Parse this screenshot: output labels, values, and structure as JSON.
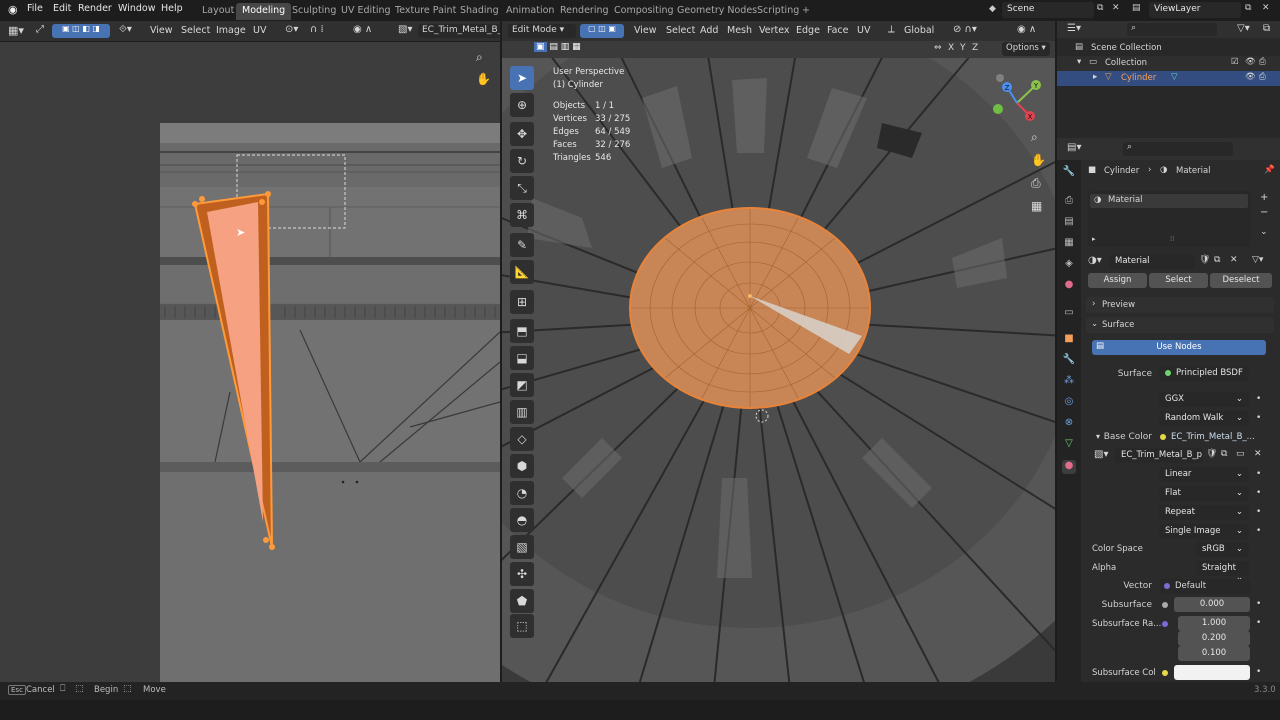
{
  "topbar": {
    "menus": [
      "File",
      "Edit",
      "Render",
      "Window",
      "Help"
    ],
    "workspaces": [
      "Layout",
      "Modeling",
      "Sculpting",
      "UV Editing",
      "Texture Paint",
      "Shading",
      "Animation",
      "Rendering",
      "Compositing",
      "Geometry Nodes",
      "Scripting"
    ],
    "active_workspace": "Modeling",
    "add_workspace": "+",
    "scene": "Scene",
    "view_layer": "ViewLayer"
  },
  "uv_editor": {
    "menus": [
      "View",
      "Select",
      "Image",
      "UV"
    ],
    "image_name": "EC_Trim_Metal_B_pr"
  },
  "viewport": {
    "mode": "Edit Mode",
    "menus": [
      "View",
      "Select",
      "Add",
      "Mesh",
      "Vertex",
      "Edge",
      "Face",
      "UV"
    ],
    "orientation": "Global",
    "axes": [
      "X",
      "Y",
      "Z"
    ],
    "options": "Options",
    "perspective": "User Perspective",
    "object_label": "(1) Cylinder",
    "stats": [
      {
        "label": "Objects",
        "value": "1 / 1"
      },
      {
        "label": "Vertices",
        "value": "33 / 275"
      },
      {
        "label": "Edges",
        "value": "64 / 549"
      },
      {
        "label": "Faces",
        "value": "32 / 276"
      },
      {
        "label": "Triangles",
        "value": "546"
      }
    ],
    "gizmo_axes": [
      "Y",
      "Z",
      "X"
    ]
  },
  "outliner": {
    "root": "Scene Collection",
    "collection": "Collection",
    "object": "Cylinder"
  },
  "properties": {
    "breadcrumb_object": "Cylinder",
    "breadcrumb_tab": "Material",
    "slot_name": "Material",
    "material_name": "Material",
    "assign": "Assign",
    "select": "Select",
    "deselect": "Deselect",
    "preview": "Preview",
    "surface_panel": "Surface",
    "use_nodes": "Use Nodes",
    "surface_label": "Surface",
    "surface_value": "Principled BSDF",
    "distribution": "GGX",
    "subsurface_method": "Random Walk",
    "base_color_label": "Base Color",
    "base_color_value": "EC_Trim_Metal_B_...",
    "image_name": "EC_Trim_Metal_B_p...",
    "interpolation": "Linear",
    "projection": "Flat",
    "extension": "Repeat",
    "source": "Single Image",
    "color_space_label": "Color Space",
    "color_space": "sRGB",
    "alpha_label": "Alpha",
    "alpha": "Straight",
    "vector_label": "Vector",
    "vector": "Default",
    "subsurface_label": "Subsurface",
    "subsurface": "0.000",
    "subsurface_radius_label": "Subsurface Ra...",
    "subsurface_radius": [
      "1.000",
      "0.200",
      "0.100"
    ],
    "subsurface_color_label": "Subsurface Col"
  },
  "statusbar": {
    "cancel": "Cancel",
    "begin": "Begin",
    "move": "Move",
    "version": "3.3.0"
  },
  "colors": {
    "accent": "#4772b3",
    "selection_orange": "#e8833a",
    "face_fill": "#f5a182",
    "header_bg": "#303030"
  }
}
